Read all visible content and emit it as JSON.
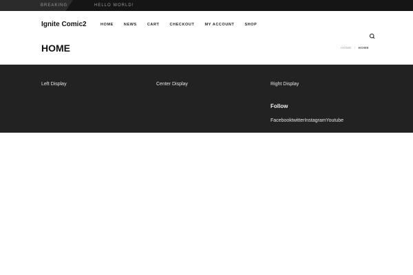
{
  "topbar": {
    "breaking_label": "BREAKING",
    "headline": "HELLO WORLD!"
  },
  "header": {
    "site_title": "Ignite Comic2",
    "nav": [
      "HOME",
      "NEWS",
      "CART",
      "CHECKOUT",
      "MY ACCOUNT",
      "SHOP"
    ],
    "search_icon": "search-icon"
  },
  "page": {
    "title": "HOME",
    "breadcrumb": [
      "HOME",
      "HOME"
    ]
  },
  "footer": {
    "left_title": "Left Display",
    "center_title": "Center Display",
    "right_title": "Right Display",
    "follow_title": "Follow",
    "follow_links": [
      "Facebook",
      "twitter",
      "Instagram",
      "Youtube"
    ]
  },
  "colors": {
    "topbar_bg": "#151515",
    "footer_bg": "#222222",
    "text_dark": "#111111"
  }
}
